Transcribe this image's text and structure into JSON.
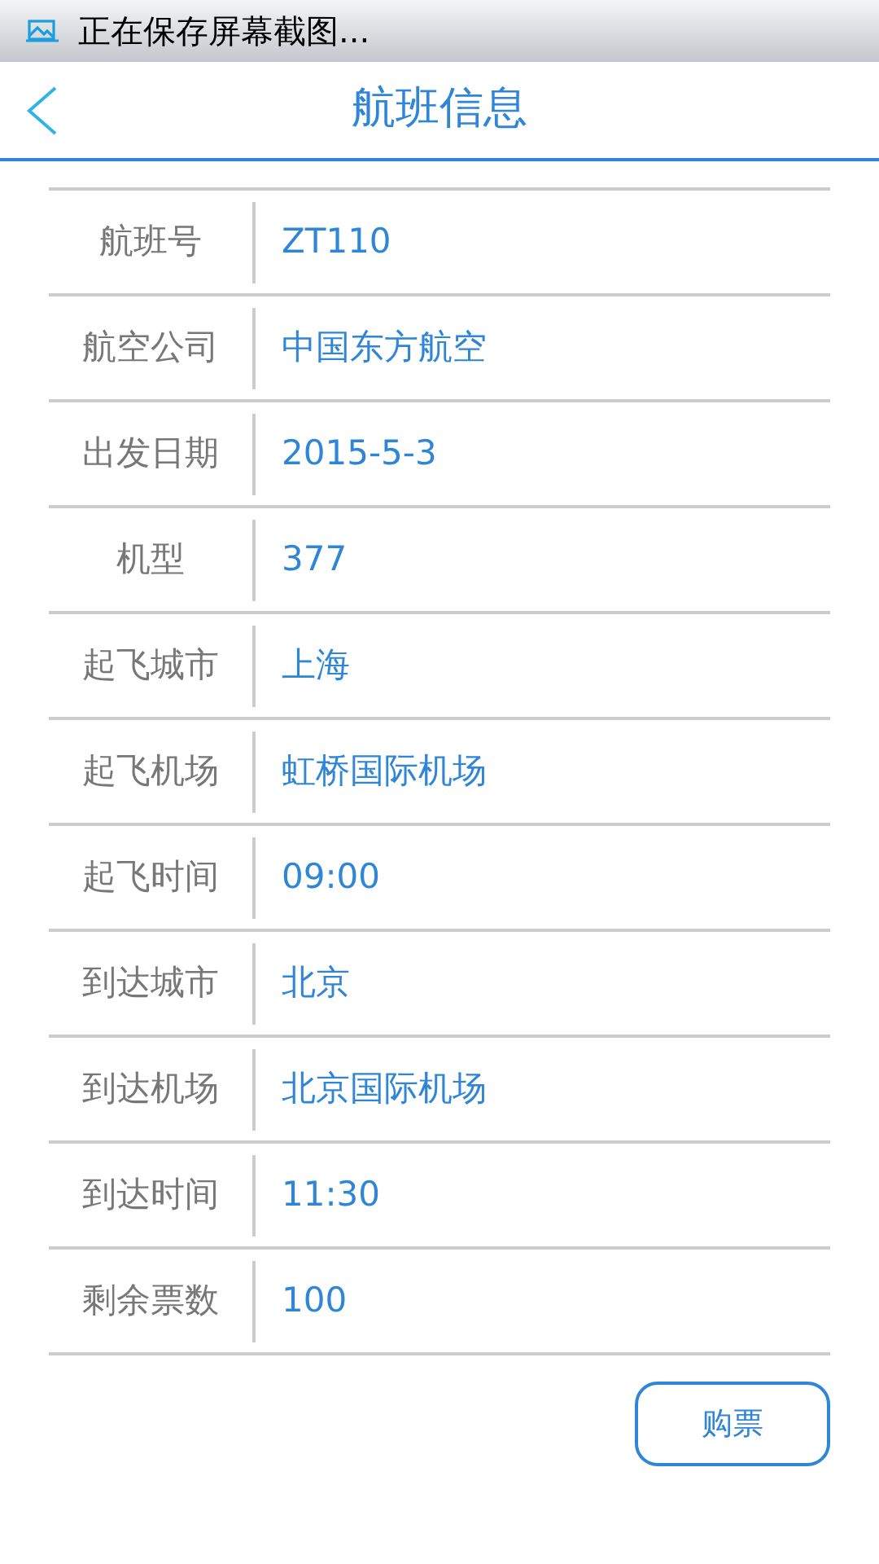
{
  "status_bar": {
    "notification": "正在保存屏幕截图..."
  },
  "header": {
    "title": "航班信息"
  },
  "rows": [
    {
      "label": "航班号",
      "value": "ZT110"
    },
    {
      "label": "航空公司",
      "value": "中国东方航空"
    },
    {
      "label": "出发日期",
      "value": "2015-5-3"
    },
    {
      "label": "机型",
      "value": "377"
    },
    {
      "label": "起飞城市",
      "value": "上海"
    },
    {
      "label": "起飞机场",
      "value": "虹桥国际机场"
    },
    {
      "label": "起飞时间",
      "value": "09:00"
    },
    {
      "label": "到达城市",
      "value": "北京"
    },
    {
      "label": "到达机场",
      "value": "北京国际机场"
    },
    {
      "label": "到达时间",
      "value": "11:30"
    },
    {
      "label": "剩余票数",
      "value": "100"
    }
  ],
  "buy_button": "购票"
}
